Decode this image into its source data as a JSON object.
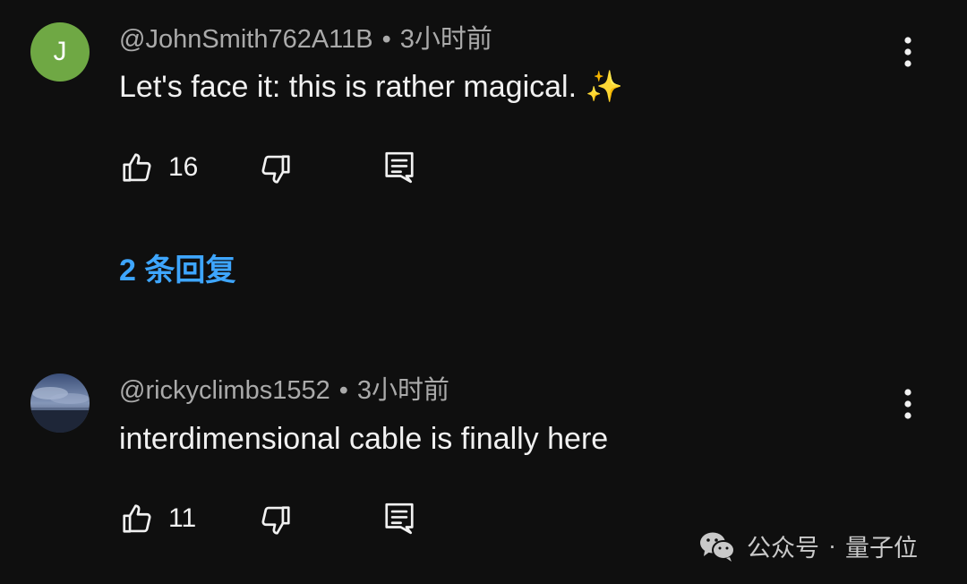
{
  "comments": [
    {
      "avatar_letter": "J",
      "author": "@JohnSmith762A11B",
      "separator": "•",
      "time": "3小时前",
      "text": "Let's face it: this is rather magical. ✨",
      "likes": "16",
      "replies_label": "2 条回复"
    },
    {
      "author": "@rickyclimbs1552",
      "separator": "•",
      "time": "3小时前",
      "text": "interdimensional cable is finally here",
      "likes": "11"
    }
  ],
  "watermark": {
    "account": "公众号",
    "separator": "·",
    "name": "量子位"
  },
  "colors": {
    "background": "#0f0f0f",
    "avatar_green": "#6fa844",
    "link_blue": "#3ea6ff",
    "meta_gray": "#aaaaaa"
  }
}
